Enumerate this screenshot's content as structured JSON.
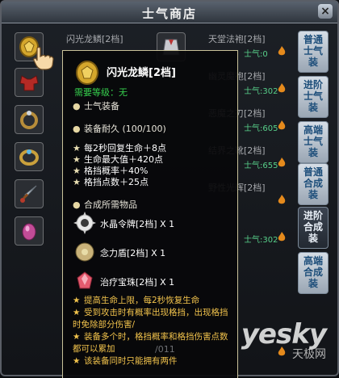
{
  "window": {
    "title": "士气商店",
    "close_label": "×"
  },
  "items": [
    {
      "name": "闪光龙鳞[2档]",
      "price": ""
    },
    {
      "name": "天堂法袍[2档]",
      "price": "士气:0"
    },
    {
      "name": "",
      "price": ""
    },
    {
      "name": "幽灵魔袍[2档]",
      "price": "士气:302"
    },
    {
      "name": "",
      "price": ""
    },
    {
      "name": "恶魔之刃[2档]",
      "price": "士气:605"
    },
    {
      "name": "",
      "price": ""
    },
    {
      "name": "结界之靴[2档]",
      "price": "士气:655"
    },
    {
      "name": "",
      "price": ""
    },
    {
      "name": "野性光辉[2档]",
      "price": ""
    },
    {
      "name": "",
      "price": ""
    },
    {
      "name": "",
      "price": "士气:302"
    }
  ],
  "tabs": [
    {
      "label": "普通士气装",
      "active": false
    },
    {
      "label": "进阶士气装",
      "active": false
    },
    {
      "label": "高端士气装",
      "active": false
    },
    {
      "label": "普通合成装",
      "active": false
    },
    {
      "label": "进阶合成装",
      "active": true
    },
    {
      "label": "高端合成装",
      "active": false
    }
  ],
  "tooltip": {
    "name": "闪光龙鳞[2档]",
    "level": "需要等级：无",
    "type": "士气装备",
    "durability": "装备耐久 (100/100)",
    "stats": [
      "每2秒回复生命＋8点",
      "生命最大值＋420点",
      "格挡概率＋40%",
      "格挡点数＋25点"
    ],
    "materials_header": "合成所需物品",
    "materials": [
      {
        "name": "水晶令牌[2档] X 1",
        "icon": "crystal-token-icon"
      },
      {
        "name": "念力盾[2档] X 1",
        "icon": "psychic-shield-icon"
      },
      {
        "name": "治疗宝珠[2档] X 1",
        "icon": "healing-orb-icon"
      }
    ],
    "description": [
      "提高生命上限，每2秒恢复生命",
      "受到攻击时有概率出现格挡，出现格挡时免除部分伤害/",
      "装备多个时，格挡概率和格挡伤害点数都可以累加",
      "该装备同时只能拥有两件"
    ],
    "footer_fragment": "/011"
  },
  "watermark": {
    "main": "yesky",
    "sub": "天极网"
  },
  "colors": {
    "level_green": "#36d04d",
    "desc_gold": "#f2c34c",
    "tab_text": "#1d4e7a"
  }
}
